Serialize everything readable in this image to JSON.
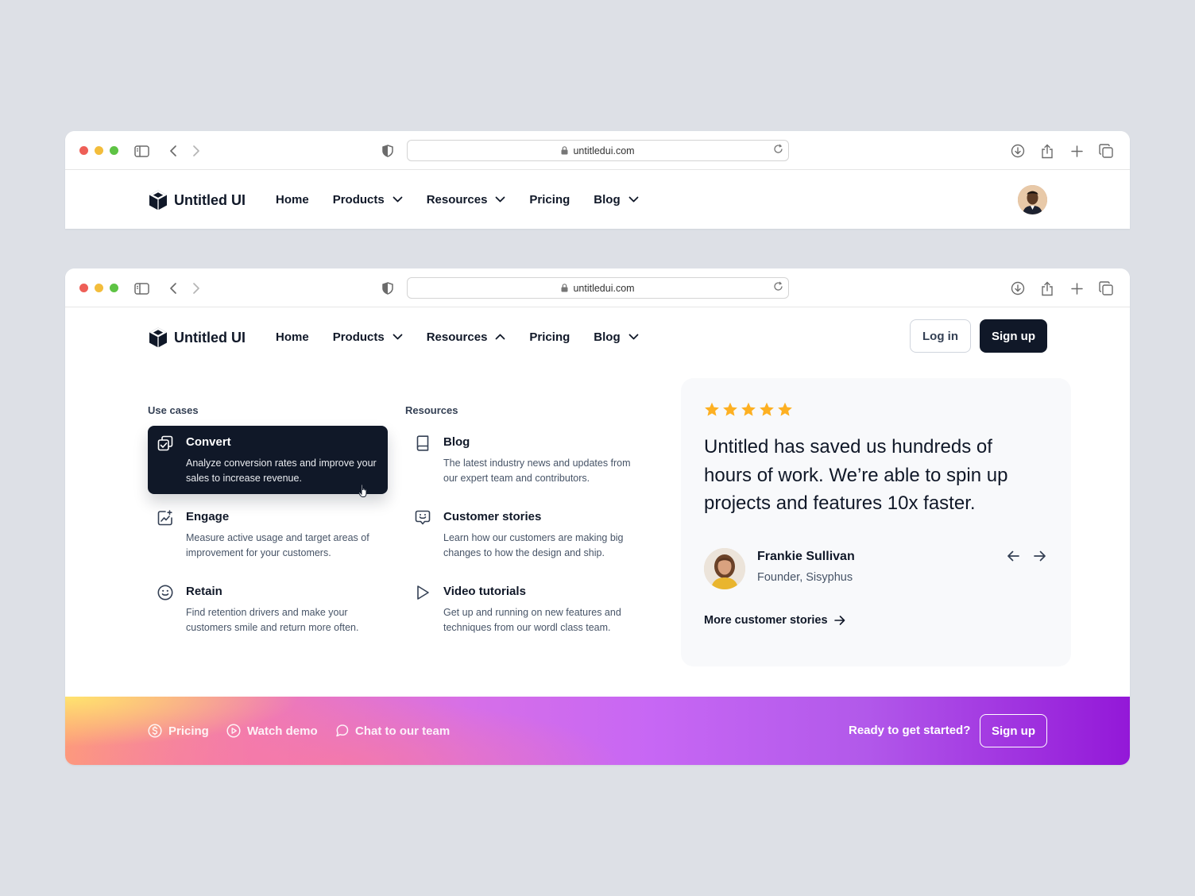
{
  "browser": {
    "url": "untitledui.com"
  },
  "nav": {
    "logo_text": "Untitled UI",
    "items": [
      {
        "label": "Home"
      },
      {
        "label": "Products"
      },
      {
        "label": "Resources"
      },
      {
        "label": "Pricing"
      },
      {
        "label": "Blog"
      }
    ],
    "login_label": "Log in",
    "signup_label": "Sign up"
  },
  "mega_menu": {
    "use_cases": {
      "title": "Use cases",
      "items": [
        {
          "title": "Convert",
          "desc": "Analyze conversion rates and improve your sales to increase revenue.",
          "icon": "convert-icon",
          "active": true
        },
        {
          "title": "Engage",
          "desc": "Measure active usage and target areas of improvement for your customers.",
          "icon": "engage-icon",
          "active": false
        },
        {
          "title": "Retain",
          "desc": "Find retention drivers and make your customers smile and return more often.",
          "icon": "smile-icon",
          "active": false
        }
      ]
    },
    "resources": {
      "title": "Resources",
      "items": [
        {
          "title": "Blog",
          "desc": "The latest industry news and updates from our expert team and contributors.",
          "icon": "book-icon"
        },
        {
          "title": "Customer stories",
          "desc": "Learn how our customers are making big changes to how the design and ship.",
          "icon": "chat-smile-icon"
        },
        {
          "title": "Video tutorials",
          "desc": "Get up and running on new features and techniques from our wordl class team.",
          "icon": "play-icon"
        }
      ]
    }
  },
  "testimonial": {
    "rating": 5,
    "quote": "Untitled has saved us hundreds of hours of work. We’re able to spin up projects and features 10x faster.",
    "name": "Frankie Sullivan",
    "role": "Founder, Sisyphus",
    "more_link": "More customer stories"
  },
  "footer": {
    "links": [
      {
        "label": "Pricing",
        "icon": "dollar-circle-icon"
      },
      {
        "label": "Watch demo",
        "icon": "play-circle-icon"
      },
      {
        "label": "Chat to our team",
        "icon": "chat-icon"
      }
    ],
    "cta_text": "Ready to get started?",
    "cta_button": "Sign up"
  },
  "colors": {
    "page_bg": "#dde0e6",
    "dark": "#101828",
    "star": "#fdb022",
    "gradient_start": "#fd9b7b",
    "gradient_end": "#9318d8"
  }
}
